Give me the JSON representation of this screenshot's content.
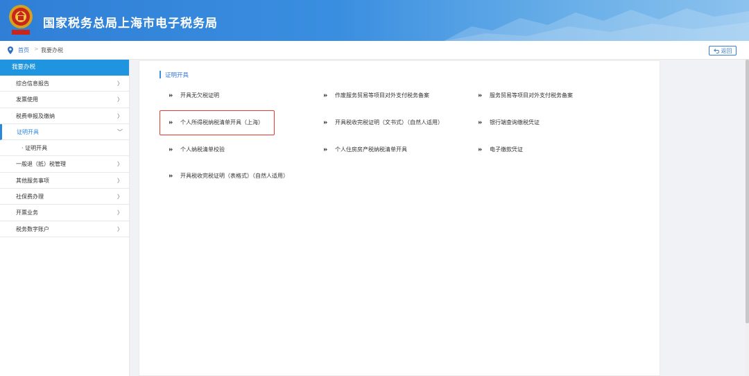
{
  "header": {
    "title": "国家税务总局上海市电子税务局",
    "emblem_icon": "tax-emblem-icon"
  },
  "breadcrumb": {
    "home": "首页",
    "separator": ">",
    "current": "我要办税",
    "back_label": "返回"
  },
  "sidebar": {
    "header": "我要办税",
    "items": [
      {
        "label": "综合信息报告",
        "chevron": "〉"
      },
      {
        "label": "发票使用",
        "chevron": "〉"
      },
      {
        "label": "税费申报及缴纳",
        "chevron": "〉"
      },
      {
        "label": "证明开具",
        "chevron": "﹀",
        "active": true
      },
      {
        "label": "证明开具",
        "prefix": "·"
      },
      {
        "label": "一般退（抵）税管理",
        "chevron": "〉"
      },
      {
        "label": "其他服务事项",
        "chevron": "〉"
      },
      {
        "label": "社保费办理",
        "chevron": "〉"
      },
      {
        "label": "开票业务",
        "chevron": "〉"
      },
      {
        "label": "税务数字账户",
        "chevron": "〉"
      }
    ]
  },
  "main": {
    "section_title": "证明开具",
    "links": [
      "开具无欠税证明",
      "作废服务贸易等项目对外支付税务备案",
      "服务贸易等项目对外支付税务备案",
      "个人所得税纳税清单开具（上海）",
      "开具税收完税证明（文书式）（自然人适用）",
      "银行端查询缴税凭证",
      "个人纳税清单校验",
      "个人住房房产税纳税清单开具",
      "电子缴款凭证",
      "开具税收完税证明（表格式）（自然人适用）"
    ]
  },
  "colors": {
    "accent": "#1f95df",
    "highlight": "#e43a2f"
  }
}
